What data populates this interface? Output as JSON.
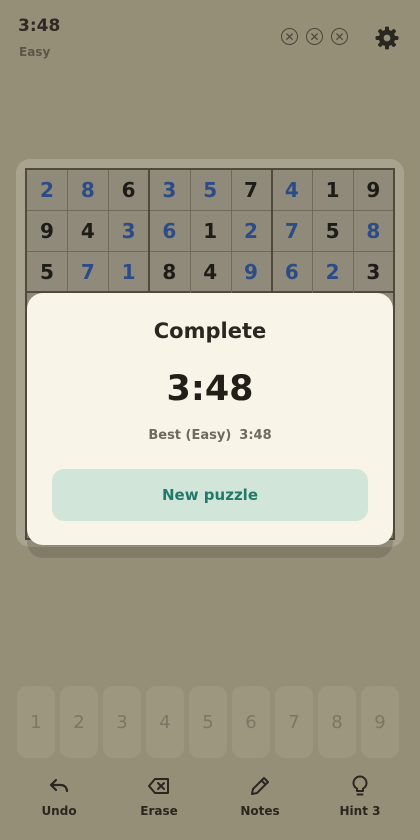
{
  "header": {
    "timer": "3:48",
    "difficulty": "Easy",
    "mistakes": [
      {
        "icon": "x-circle-icon",
        "symbol": "✕"
      },
      {
        "icon": "x-circle-icon",
        "symbol": "✕"
      },
      {
        "icon": "x-circle-icon",
        "symbol": "✕"
      }
    ],
    "settings_icon": "gear-icon"
  },
  "board": {
    "rows": [
      [
        2,
        8,
        6,
        3,
        5,
        7,
        4,
        1,
        9
      ],
      [
        9,
        4,
        3,
        6,
        1,
        2,
        7,
        5,
        8
      ],
      [
        5,
        7,
        1,
        8,
        4,
        9,
        6,
        2,
        3
      ]
    ],
    "user_entries": [
      [
        1,
        1,
        0,
        1,
        1,
        0,
        1,
        0,
        0
      ],
      [
        0,
        0,
        1,
        1,
        0,
        1,
        1,
        0,
        1
      ],
      [
        0,
        1,
        1,
        0,
        0,
        1,
        1,
        1,
        0
      ]
    ],
    "colors": {
      "given": "#1e1c17",
      "user": "#2d4c87"
    }
  },
  "dialog": {
    "title": "Complete",
    "time": "3:48",
    "best_label": "Best (Easy)",
    "best_time": "3:48",
    "button_label": "New puzzle"
  },
  "numpad": [
    "1",
    "2",
    "3",
    "4",
    "5",
    "6",
    "7",
    "8",
    "9"
  ],
  "toolbar": {
    "undo": {
      "label": "Undo",
      "icon": "undo-icon"
    },
    "erase": {
      "label": "Erase",
      "icon": "erase-icon"
    },
    "notes": {
      "label": "Notes",
      "icon": "pencil-icon"
    },
    "hint": {
      "label": "Hint 3",
      "icon": "lightbulb-icon"
    }
  },
  "colors": {
    "background": "#968f78",
    "dialog_bg": "#f8f4e8",
    "button_bg": "#d2e5d9",
    "button_text": "#227a6a"
  }
}
